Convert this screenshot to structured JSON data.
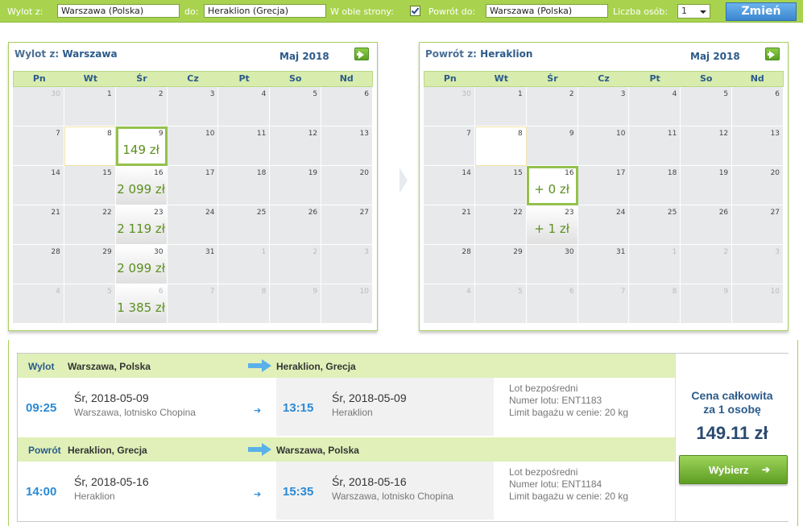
{
  "search": {
    "from_label": "Wylot z:",
    "from_value": "Warszawa (Polska)",
    "to_label": "do:",
    "to_value": "Heraklion (Grecja)",
    "both_ways_label": "W obie strony:",
    "both_ways_checked": true,
    "return_label": "Powrót do:",
    "return_value": "Warszawa (Polska)",
    "persons_label": "Liczba osób:",
    "persons_value": "1",
    "change_button": "Zmień"
  },
  "calendars": {
    "weekdays": [
      "Pn",
      "Wt",
      "Śr",
      "Cz",
      "Pt",
      "So",
      "Nd"
    ],
    "outbound": {
      "title_prefix": "Wylot z:",
      "title_city": "Warszawa",
      "month": "Maj 2018",
      "weeks": [
        [
          {
            "d": "30",
            "o": true
          },
          {
            "d": "1"
          },
          {
            "d": "2"
          },
          {
            "d": "3"
          },
          {
            "d": "4"
          },
          {
            "d": "5"
          },
          {
            "d": "6"
          }
        ],
        [
          {
            "d": "7"
          },
          {
            "d": "8",
            "hl": true
          },
          {
            "d": "9",
            "p": "149 zł",
            "sel": true
          },
          {
            "d": "10"
          },
          {
            "d": "11"
          },
          {
            "d": "12"
          },
          {
            "d": "13"
          }
        ],
        [
          {
            "d": "14"
          },
          {
            "d": "15"
          },
          {
            "d": "16",
            "p": "2 099 zł"
          },
          {
            "d": "17"
          },
          {
            "d": "18"
          },
          {
            "d": "19"
          },
          {
            "d": "20"
          }
        ],
        [
          {
            "d": "21"
          },
          {
            "d": "22"
          },
          {
            "d": "23",
            "p": "2 119 zł"
          },
          {
            "d": "24"
          },
          {
            "d": "25"
          },
          {
            "d": "26"
          },
          {
            "d": "27"
          }
        ],
        [
          {
            "d": "28"
          },
          {
            "d": "29"
          },
          {
            "d": "30",
            "p": "2 099 zł"
          },
          {
            "d": "31"
          },
          {
            "d": "1",
            "o": true
          },
          {
            "d": "2",
            "o": true
          },
          {
            "d": "3",
            "o": true
          }
        ],
        [
          {
            "d": "4",
            "o": true
          },
          {
            "d": "5",
            "o": true
          },
          {
            "d": "6",
            "o": true,
            "p": "1 385 zł"
          },
          {
            "d": "7",
            "o": true
          },
          {
            "d": "8",
            "o": true
          },
          {
            "d": "9",
            "o": true
          },
          {
            "d": "10",
            "o": true
          }
        ]
      ]
    },
    "return": {
      "title_prefix": "Powrót z:",
      "title_city": "Heraklion",
      "month": "Maj 2018",
      "weeks": [
        [
          {
            "d": "30",
            "o": true
          },
          {
            "d": "1"
          },
          {
            "d": "2"
          },
          {
            "d": "3"
          },
          {
            "d": "4"
          },
          {
            "d": "5"
          },
          {
            "d": "6"
          }
        ],
        [
          {
            "d": "7"
          },
          {
            "d": "8",
            "hl": true
          },
          {
            "d": "9"
          },
          {
            "d": "10"
          },
          {
            "d": "11"
          },
          {
            "d": "12"
          },
          {
            "d": "13"
          }
        ],
        [
          {
            "d": "14"
          },
          {
            "d": "15"
          },
          {
            "d": "16",
            "p": "+ 0 zł",
            "sel": true
          },
          {
            "d": "17"
          },
          {
            "d": "18"
          },
          {
            "d": "19"
          },
          {
            "d": "20"
          }
        ],
        [
          {
            "d": "21"
          },
          {
            "d": "22"
          },
          {
            "d": "23",
            "p": "+ 1 zł"
          },
          {
            "d": "24"
          },
          {
            "d": "25"
          },
          {
            "d": "26"
          },
          {
            "d": "27"
          }
        ],
        [
          {
            "d": "28"
          },
          {
            "d": "29"
          },
          {
            "d": "30"
          },
          {
            "d": "31"
          },
          {
            "d": "1",
            "o": true
          },
          {
            "d": "2",
            "o": true
          },
          {
            "d": "3",
            "o": true
          }
        ],
        [
          {
            "d": "4",
            "o": true
          },
          {
            "d": "5",
            "o": true
          },
          {
            "d": "6",
            "o": true
          },
          {
            "d": "7",
            "o": true
          },
          {
            "d": "8",
            "o": true
          },
          {
            "d": "9",
            "o": true
          },
          {
            "d": "10",
            "o": true
          }
        ]
      ]
    }
  },
  "outbound": {
    "tag": "Wylot",
    "from": "Warszawa, Polska",
    "to": "Heraklion, Grecja",
    "dep_time": "09:25",
    "dep_date": "Śr, 2018-05-09",
    "dep_place": "Warszawa, lotnisko Chopina",
    "arr_time": "13:15",
    "arr_date": "Śr, 2018-05-09",
    "arr_place": "Heraklion",
    "info_direct": "Lot bezpośredni",
    "info_flight": "Numer lotu: ENT1183",
    "info_baggage": "Limit bagażu w cenie: 20 kg"
  },
  "return_flight": {
    "tag": "Powrót",
    "from": "Heraklion, Grecja",
    "to": "Warszawa, Polska",
    "dep_time": "14:00",
    "dep_date": "Śr, 2018-05-16",
    "dep_place": "Heraklion",
    "arr_time": "15:35",
    "arr_date": "Śr, 2018-05-16",
    "arr_place": "Warszawa, lotnisko Chopina",
    "info_direct": "Lot bezpośredni",
    "info_flight": "Numer lotu: ENT1184",
    "info_baggage": "Limit bagażu w cenie: 20 kg"
  },
  "total": {
    "label_line1": "Cena całkowita",
    "label_line2": "za 1 osobę",
    "price": "149.11 zł",
    "choose_button": "Wybierz",
    "choose_arrow": "➔"
  },
  "colors": {
    "accent_green": "#a9d34f",
    "price_green": "#5c8f1f",
    "link_blue": "#2a8ad6",
    "heading_blue": "#2b5a8a"
  }
}
